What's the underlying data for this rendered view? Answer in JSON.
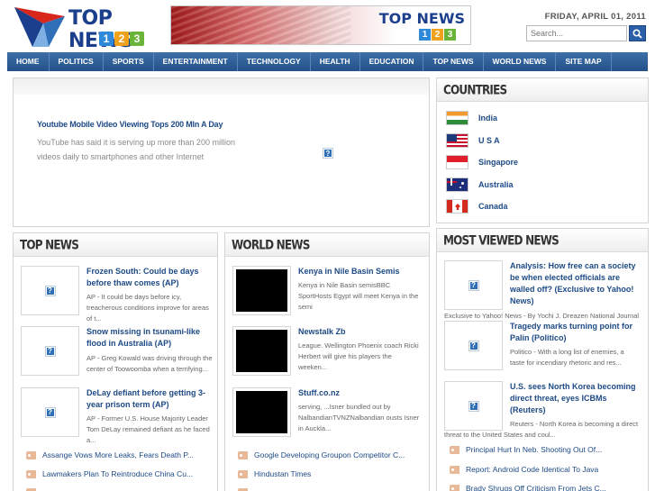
{
  "site": {
    "logo_text": "TOP NEWS",
    "logo_digits": [
      "1",
      "2",
      "3"
    ],
    "banner_title": "TOP NEWS",
    "banner_digits": [
      "1",
      "2",
      "3"
    ],
    "date": "FRIDAY, APRIL 01, 2011",
    "search_placeholder": "Search..."
  },
  "nav": [
    "HOME",
    "POLITICS",
    "SPORTS",
    "ENTERTAINMENT",
    "TECHNOLOGY",
    "HEALTH",
    "EDUCATION",
    "TOP NEWS",
    "WORLD NEWS",
    "SITE MAP"
  ],
  "feature": {
    "title": "Youtube Mobile Video Viewing Tops 200 Mln A Day",
    "text": "YouTube has said it is serving up more than 200 million videos daily to smartphones and other Internet"
  },
  "countries": {
    "title": "COUNTRIES",
    "items": [
      "India",
      "U S A",
      "Singapore",
      "Australia",
      "Canada"
    ]
  },
  "top_news": {
    "title": "TOP NEWS",
    "stories": [
      {
        "title": "Frozen South: Could be days before thaw comes (AP)",
        "desc": "AP - It could be days before icy, treacherous conditions improve for areas of t..."
      },
      {
        "title": "Snow missing in tsunami-like flood in Australia (AP)",
        "desc": "AP - Greg Kowald was driving through the center of Toowoomba when a terrifying..."
      },
      {
        "title": "DeLay defiant before getting 3-year prison term (AP)",
        "desc": "AP - Former U.S. House Majority Leader Tom DeLay remained defiant as he faced a..."
      }
    ],
    "links": [
      "Assange Vows More Leaks, Fears Death P...",
      "Lawmakers Plan To Reintroduce China Cu..."
    ]
  },
  "world_news": {
    "title": "WORLD NEWS",
    "stories": [
      {
        "title": "Kenya in Nile Basin Semis",
        "desc": "Kenya in Nile Basin semisBBC SportHosts Egypt will meet Kenya in the semi"
      },
      {
        "title": "Newstalk Zb",
        "desc": "League. Wellington Phoenix coach Ricki Herbert will give his players the weeken..."
      },
      {
        "title": "Stuff.co.nz",
        "desc": "serving, ...Isner bundled out by NalbandianTVNZNalbandian ousts Isner in Auckla..."
      }
    ],
    "links": [
      "Google Developing Groupon Competitor C...",
      "Hindustan Times"
    ]
  },
  "most_viewed": {
    "title": "MOST VIEWED NEWS",
    "stories": [
      {
        "title": "Analysis: How free can a society be when elected officials are walled off? (Exclusive to Yahoo! News)",
        "desc": "Exclusive to Yahoo! News - By Yochi J. Dreazen National Journal Its hard to re"
      },
      {
        "title": "Tragedy marks turning point for Palin (Politico)",
        "desc": "Politico - With a long list of enemies, a taste for incendiary rhetoric and res..."
      },
      {
        "title": "U.S. sees North Korea becoming direct threat, eyes ICBMs (Reuters)",
        "desc": "Reuters - North Korea is becoming a direct threat to the United States and coul..."
      }
    ],
    "links": [
      "Principal Hurt In Neb. Shooting Out Of...",
      "Report: Android Code Identical To Java",
      "Brady Shrugs Off Criticism From Jets C..."
    ]
  },
  "colors": {
    "nav": "#24518a",
    "link": "#1d4a86",
    "logo_blue": "#1b3f8c",
    "digit_1": "#2e8ad8",
    "digit_2": "#f0a21c",
    "digit_3": "#6bb43a"
  },
  "icons": [
    "placeholder-image-icon",
    "search-icon",
    "tag-icon"
  ]
}
